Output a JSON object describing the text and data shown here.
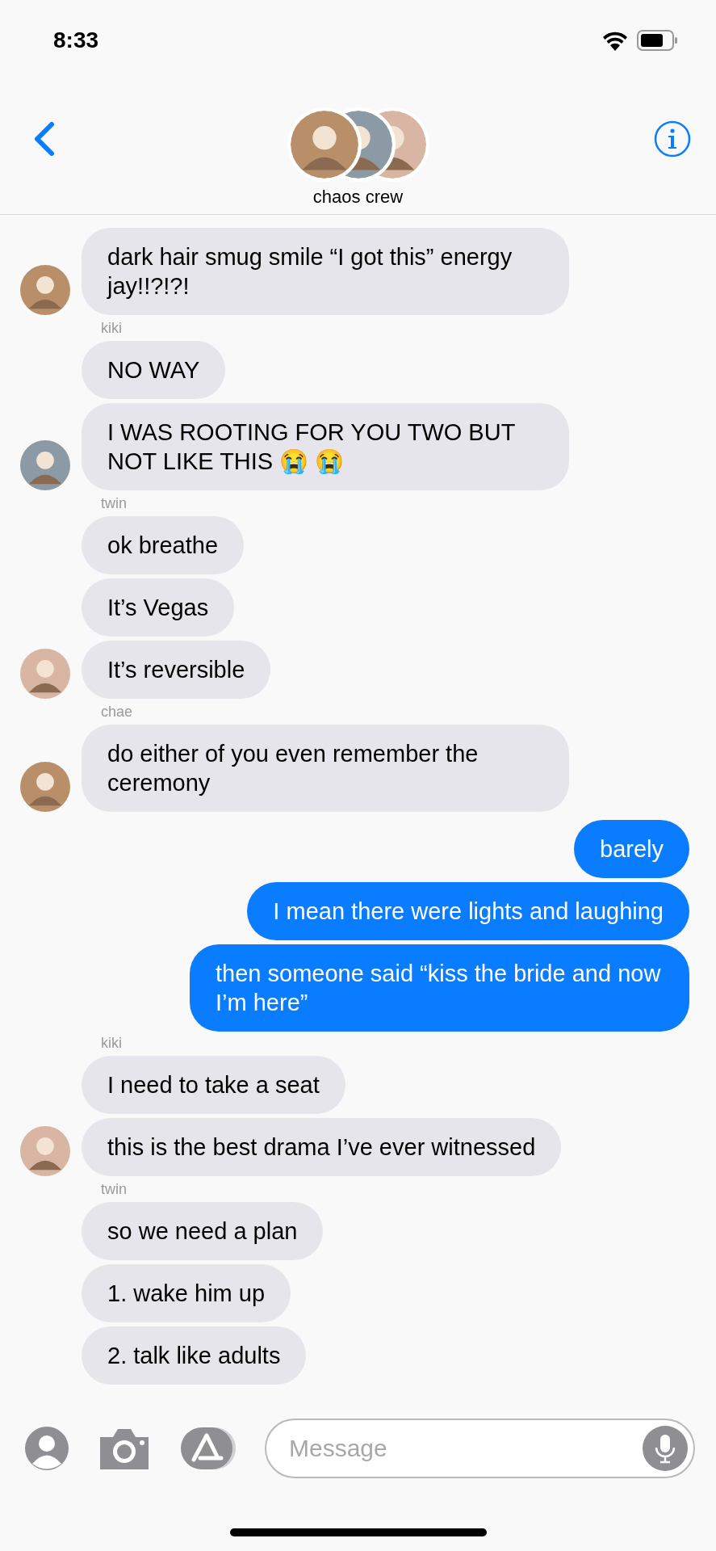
{
  "status_bar": {
    "time": "8:33"
  },
  "header": {
    "title": "chaos crew"
  },
  "groups": [
    {
      "kind": "incoming",
      "avatar": true,
      "messages": [
        "dark hair smug smile “I got this” energy jay!!?!?!"
      ]
    },
    {
      "kind": "incoming",
      "sender": "kiki",
      "avatar": true,
      "messages": [
        "NO WAY",
        "I WAS ROOTING FOR YOU TWO BUT NOT LIKE THIS 😭 😭"
      ]
    },
    {
      "kind": "incoming",
      "sender": "twin",
      "avatar": true,
      "messages": [
        "ok breathe",
        "It’s Vegas",
        "It’s reversible"
      ]
    },
    {
      "kind": "incoming",
      "sender": "chae",
      "avatar": true,
      "messages": [
        "do either of you even remember the ceremony"
      ]
    },
    {
      "kind": "outgoing",
      "messages": [
        "barely",
        "I mean there were lights and laughing",
        "then someone said “kiss the bride and now I’m here”"
      ]
    },
    {
      "kind": "incoming",
      "sender": "kiki",
      "avatar": true,
      "messages": [
        "I need to take a seat",
        "this is the best drama I’ve ever witnessed"
      ]
    },
    {
      "kind": "incoming",
      "sender": "twin",
      "avatar": false,
      "messages": [
        "so we need a plan",
        "1. wake him up",
        "2. talk like adults"
      ]
    }
  ],
  "composer": {
    "placeholder": "Message"
  }
}
